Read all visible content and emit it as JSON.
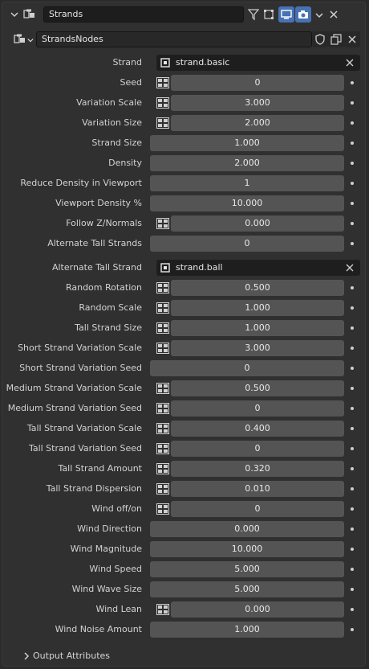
{
  "header": {
    "object_name": "Strands"
  },
  "nodebar": {
    "node_group_name": "StrandsNodes"
  },
  "rows": [
    {
      "label": "Strand",
      "type": "object",
      "value": "strand.basic"
    },
    {
      "label": "Seed",
      "type": "socket",
      "value": "0"
    },
    {
      "label": "Variation Scale",
      "type": "socket",
      "value": "3.000"
    },
    {
      "label": "Variation Size",
      "type": "socket",
      "value": "2.000"
    },
    {
      "label": "Strand Size",
      "type": "plain",
      "value": "1.000"
    },
    {
      "label": "Density",
      "type": "plain",
      "value": "2.000"
    },
    {
      "label": "Reduce Density in Viewport",
      "type": "plain",
      "value": "1"
    },
    {
      "label": "Viewport Density %",
      "type": "plain",
      "value": "10.000"
    },
    {
      "label": "Follow Z/Normals",
      "type": "socket",
      "value": "0.000"
    },
    {
      "label": "Alternate Tall Strands",
      "type": "plain",
      "value": "0"
    },
    {
      "label": "Alternate Tall Strand",
      "type": "object",
      "value": "strand.ball"
    },
    {
      "label": "Random Rotation",
      "type": "socket",
      "value": "0.500"
    },
    {
      "label": "Random Scale",
      "type": "socket",
      "value": "1.000"
    },
    {
      "label": "Tall Strand Size",
      "type": "socket",
      "value": "1.000"
    },
    {
      "label": "Short Strand Variation Scale",
      "type": "socket",
      "value": "3.000"
    },
    {
      "label": "Short Strand Variation Seed",
      "type": "plain",
      "value": "0"
    },
    {
      "label": "Medium Strand Variation Scale",
      "type": "socket",
      "value": "0.500"
    },
    {
      "label": "Medium Strand Variation Seed",
      "type": "socket",
      "value": "0"
    },
    {
      "label": "Tall Strand Variation Scale",
      "type": "socket",
      "value": "0.400"
    },
    {
      "label": "Tall Strand Variation Seed",
      "type": "socket",
      "value": "0"
    },
    {
      "label": "Tall Strand Amount",
      "type": "socket",
      "value": "0.320"
    },
    {
      "label": "Tall Strand Dispersion",
      "type": "socket",
      "value": "0.010"
    },
    {
      "label": "Wind off/on",
      "type": "socket",
      "value": "0"
    },
    {
      "label": "Wind Direction",
      "type": "plain",
      "value": "0.000"
    },
    {
      "label": "Wind Magnitude",
      "type": "plain",
      "value": "10.000"
    },
    {
      "label": "Wind Speed",
      "type": "plain",
      "value": "5.000"
    },
    {
      "label": "Wind Wave Size",
      "type": "plain",
      "value": "5.000"
    },
    {
      "label": "Wind Lean",
      "type": "socket",
      "value": "0.000"
    },
    {
      "label": "Wind Noise Amount",
      "type": "plain",
      "value": "1.000"
    }
  ],
  "footer": {
    "label": "Output Attributes"
  },
  "colors": {
    "accent": "#4772b3",
    "field": "#545454",
    "objfield": "#1e1e1e",
    "panel": "#303030"
  }
}
